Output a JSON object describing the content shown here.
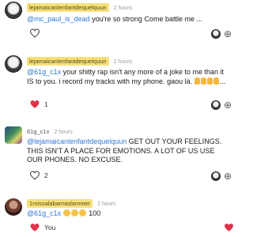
{
  "comments": [
    {
      "username": "lejamaicanlenfantdequelquun",
      "time": "2 hours",
      "mention": "@mc_paul_is_dead",
      "text": " you're so strong Come battle  me ..."
    },
    {
      "username": "lejamaicanlenfantdequelquun",
      "time": "2 hours",
      "mention": "@61g_c1x",
      "text": " your shitty rap isn't any more of a joke to me than it IS to you. i record my tracks with my phone. gaou là. ",
      "trail": "...",
      "like_count": "1"
    },
    {
      "username": "61g_c1x",
      "time": "2 hours",
      "mention": "@lejamaicanlenfantdequelquun",
      "text": " GET OUT YOUR FEELINGS. THIS ISN'T A PLACE FOR EMOTIONS. A LOT OF US USE OUR PHONES. NO EXCUSE.",
      "like_count": "2"
    },
    {
      "username": "1missalabamaslammer",
      "time": "2 hours",
      "mention": "@61g_c1x",
      "text": "100",
      "like_label": "You"
    }
  ],
  "icons": {
    "heart_color": "#e0324b",
    "mention_color": "#2d7ad6",
    "username_highlight": "#f7e07a"
  }
}
